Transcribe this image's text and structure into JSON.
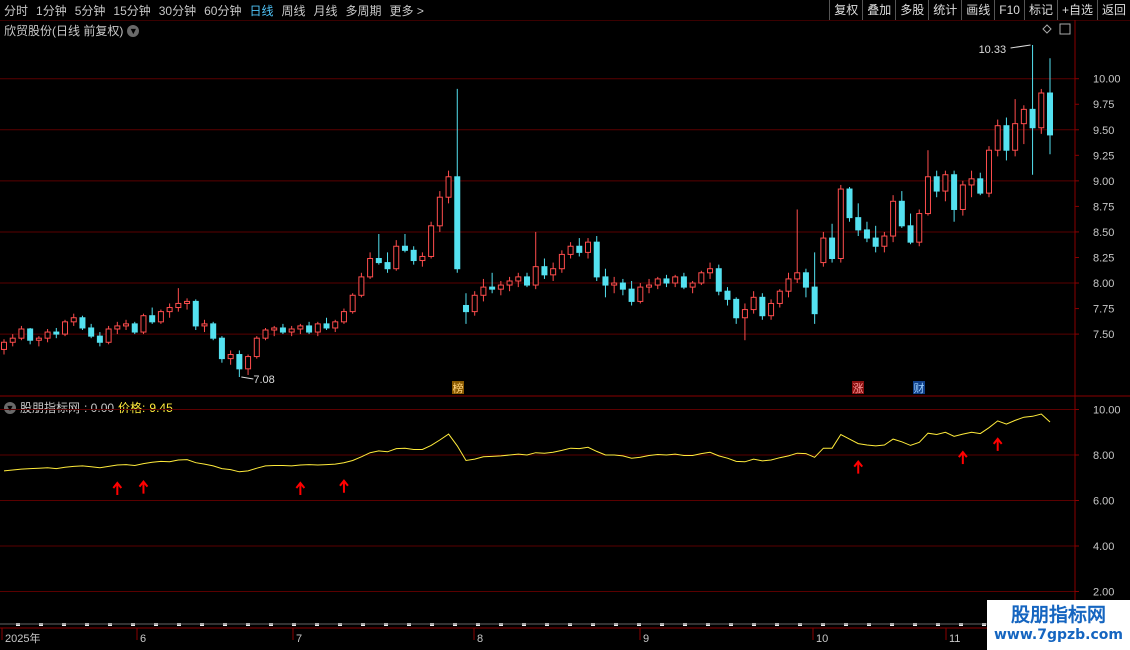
{
  "toolbar": {
    "periods": [
      "分时",
      "1分钟",
      "5分钟",
      "15分钟",
      "30分钟",
      "60分钟",
      "日线",
      "周线",
      "月线",
      "多周期",
      "更多 >"
    ],
    "active_index": 6,
    "tools": [
      "复权",
      "叠加",
      "多股",
      "统计",
      "画线",
      "F10",
      "标记",
      "+自选",
      "返回"
    ]
  },
  "main_chart": {
    "title": "欣贸股份(日线 前复权)",
    "y_axis_ticks": [
      "10.00",
      "9.75",
      "9.50",
      "9.25",
      "9.00",
      "8.75",
      "8.50",
      "8.25",
      "8.00",
      "7.75",
      "7.50"
    ],
    "high_label": "10.33",
    "low_label": "7.08",
    "event_markers": [
      "榜",
      "涨",
      "财"
    ]
  },
  "indicator": {
    "name": "股朋指标网",
    "value_text": ": 0.00",
    "price_label": "价格:",
    "price_value": "9.45",
    "y_axis_ticks": [
      "10.00",
      "8.00",
      "6.00",
      "4.00",
      "2.00"
    ]
  },
  "time_axis": {
    "labels": [
      "2025年",
      "6",
      "7",
      "8",
      "9",
      "10",
      "11"
    ]
  },
  "watermark": {
    "name": "股朋指标网",
    "url": "www.7gpzb.com"
  },
  "colors": {
    "up": "#ff4d4d",
    "down": "#54e1f0",
    "price_line": "#ffeb3b",
    "grid": "#5a0000",
    "axis_text": "#c8c8c8",
    "arrow": "#ff0000"
  },
  "chart_data": {
    "type": "candlestick",
    "period": "daily",
    "price_range": [
      7.0,
      10.4
    ],
    "candles": [
      [
        7.35,
        7.45,
        7.3,
        7.42
      ],
      [
        7.42,
        7.5,
        7.38,
        7.46
      ],
      [
        7.46,
        7.58,
        7.44,
        7.55
      ],
      [
        7.55,
        7.56,
        7.4,
        7.44
      ],
      [
        7.44,
        7.48,
        7.38,
        7.46
      ],
      [
        7.46,
        7.55,
        7.42,
        7.52
      ],
      [
        7.52,
        7.56,
        7.46,
        7.5
      ],
      [
        7.5,
        7.64,
        7.48,
        7.62
      ],
      [
        7.62,
        7.7,
        7.58,
        7.66
      ],
      [
        7.66,
        7.68,
        7.54,
        7.56
      ],
      [
        7.56,
        7.6,
        7.46,
        7.48
      ],
      [
        7.48,
        7.52,
        7.38,
        7.42
      ],
      [
        7.42,
        7.58,
        7.4,
        7.55
      ],
      [
        7.55,
        7.62,
        7.5,
        7.58
      ],
      [
        7.58,
        7.64,
        7.54,
        7.6
      ],
      [
        7.6,
        7.62,
        7.5,
        7.52
      ],
      [
        7.52,
        7.7,
        7.5,
        7.68
      ],
      [
        7.68,
        7.76,
        7.6,
        7.62
      ],
      [
        7.62,
        7.74,
        7.6,
        7.72
      ],
      [
        7.72,
        7.8,
        7.66,
        7.76
      ],
      [
        7.76,
        7.95,
        7.72,
        7.8
      ],
      [
        7.8,
        7.85,
        7.74,
        7.82
      ],
      [
        7.82,
        7.84,
        7.54,
        7.58
      ],
      [
        7.58,
        7.64,
        7.52,
        7.6
      ],
      [
        7.6,
        7.62,
        7.44,
        7.46
      ],
      [
        7.46,
        7.48,
        7.22,
        7.26
      ],
      [
        7.26,
        7.34,
        7.2,
        7.3
      ],
      [
        7.3,
        7.34,
        7.08,
        7.16
      ],
      [
        7.16,
        7.3,
        7.1,
        7.28
      ],
      [
        7.28,
        7.48,
        7.26,
        7.46
      ],
      [
        7.46,
        7.56,
        7.44,
        7.54
      ],
      [
        7.54,
        7.58,
        7.48,
        7.56
      ],
      [
        7.56,
        7.6,
        7.5,
        7.52
      ],
      [
        7.52,
        7.58,
        7.48,
        7.55
      ],
      [
        7.55,
        7.6,
        7.5,
        7.58
      ],
      [
        7.58,
        7.62,
        7.5,
        7.52
      ],
      [
        7.52,
        7.62,
        7.48,
        7.6
      ],
      [
        7.6,
        7.66,
        7.54,
        7.56
      ],
      [
        7.56,
        7.64,
        7.52,
        7.62
      ],
      [
        7.62,
        7.75,
        7.6,
        7.72
      ],
      [
        7.72,
        7.9,
        7.7,
        7.88
      ],
      [
        7.88,
        8.1,
        7.86,
        8.06
      ],
      [
        8.06,
        8.3,
        8.04,
        8.24
      ],
      [
        8.24,
        8.48,
        8.18,
        8.2
      ],
      [
        8.2,
        8.3,
        8.1,
        8.14
      ],
      [
        8.14,
        8.42,
        8.12,
        8.36
      ],
      [
        8.36,
        8.48,
        8.3,
        8.32
      ],
      [
        8.32,
        8.36,
        8.18,
        8.22
      ],
      [
        8.22,
        8.3,
        8.16,
        8.26
      ],
      [
        8.26,
        8.6,
        8.24,
        8.56
      ],
      [
        8.56,
        8.9,
        8.5,
        8.84
      ],
      [
        8.84,
        9.1,
        8.78,
        9.04
      ],
      [
        9.04,
        9.9,
        8.1,
        8.14
      ],
      [
        7.78,
        7.9,
        7.6,
        7.72
      ],
      [
        7.72,
        7.92,
        7.68,
        7.88
      ],
      [
        7.88,
        8.04,
        7.82,
        7.96
      ],
      [
        7.96,
        8.1,
        7.9,
        7.94
      ],
      [
        7.94,
        8.02,
        7.88,
        7.98
      ],
      [
        7.98,
        8.06,
        7.92,
        8.02
      ],
      [
        8.02,
        8.1,
        7.96,
        8.06
      ],
      [
        8.06,
        8.1,
        7.96,
        7.98
      ],
      [
        7.98,
        8.5,
        7.94,
        8.16
      ],
      [
        8.16,
        8.24,
        8.04,
        8.08
      ],
      [
        8.08,
        8.2,
        8.02,
        8.14
      ],
      [
        8.14,
        8.32,
        8.1,
        8.28
      ],
      [
        8.28,
        8.4,
        8.24,
        8.36
      ],
      [
        8.36,
        8.44,
        8.26,
        8.3
      ],
      [
        8.3,
        8.44,
        8.24,
        8.4
      ],
      [
        8.4,
        8.46,
        8.02,
        8.06
      ],
      [
        8.06,
        8.14,
        7.86,
        7.98
      ],
      [
        7.98,
        8.06,
        7.9,
        8.0
      ],
      [
        8.0,
        8.04,
        7.88,
        7.94
      ],
      [
        7.94,
        8.02,
        7.78,
        7.82
      ],
      [
        7.82,
        8.0,
        7.8,
        7.96
      ],
      [
        7.96,
        8.04,
        7.9,
        7.98
      ],
      [
        7.98,
        8.06,
        7.94,
        8.04
      ],
      [
        8.04,
        8.08,
        7.96,
        8.0
      ],
      [
        8.0,
        8.08,
        7.96,
        8.06
      ],
      [
        8.06,
        8.1,
        7.94,
        7.96
      ],
      [
        7.96,
        8.02,
        7.9,
        8.0
      ],
      [
        8.0,
        8.12,
        7.98,
        8.1
      ],
      [
        8.1,
        8.2,
        8.04,
        8.14
      ],
      [
        8.14,
        8.18,
        7.88,
        7.92
      ],
      [
        7.92,
        7.96,
        7.78,
        7.84
      ],
      [
        7.84,
        7.86,
        7.6,
        7.66
      ],
      [
        7.66,
        7.8,
        7.44,
        7.74
      ],
      [
        7.74,
        7.92,
        7.7,
        7.86
      ],
      [
        7.86,
        7.9,
        7.64,
        7.68
      ],
      [
        7.68,
        7.84,
        7.64,
        7.8
      ],
      [
        7.8,
        7.94,
        7.76,
        7.92
      ],
      [
        7.92,
        8.1,
        7.86,
        8.04
      ],
      [
        8.04,
        8.72,
        8.0,
        8.1
      ],
      [
        8.1,
        8.14,
        7.86,
        7.96
      ],
      [
        7.96,
        8.3,
        7.6,
        7.7
      ],
      [
        8.2,
        8.5,
        8.16,
        8.44
      ],
      [
        8.44,
        8.58,
        8.2,
        8.24
      ],
      [
        8.24,
        8.96,
        8.2,
        8.92
      ],
      [
        8.92,
        8.94,
        8.6,
        8.64
      ],
      [
        8.64,
        8.78,
        8.46,
        8.52
      ],
      [
        8.52,
        8.6,
        8.4,
        8.44
      ],
      [
        8.44,
        8.56,
        8.3,
        8.36
      ],
      [
        8.36,
        8.5,
        8.3,
        8.46
      ],
      [
        8.46,
        8.86,
        8.4,
        8.8
      ],
      [
        8.8,
        8.9,
        8.54,
        8.56
      ],
      [
        8.56,
        8.68,
        8.38,
        8.4
      ],
      [
        8.4,
        8.72,
        8.36,
        8.68
      ],
      [
        8.68,
        9.3,
        8.66,
        9.04
      ],
      [
        9.04,
        9.1,
        8.84,
        8.9
      ],
      [
        8.9,
        9.1,
        8.8,
        9.06
      ],
      [
        9.06,
        9.1,
        8.6,
        8.72
      ],
      [
        8.72,
        9.0,
        8.66,
        8.96
      ],
      [
        8.96,
        9.1,
        8.84,
        9.02
      ],
      [
        9.02,
        9.08,
        8.86,
        8.88
      ],
      [
        8.88,
        9.34,
        8.84,
        9.3
      ],
      [
        9.3,
        9.6,
        9.24,
        9.54
      ],
      [
        9.54,
        9.62,
        9.2,
        9.3
      ],
      [
        9.3,
        9.8,
        9.24,
        9.56
      ],
      [
        9.56,
        9.74,
        9.36,
        9.7
      ],
      [
        9.7,
        10.33,
        9.06,
        9.52
      ],
      [
        9.52,
        9.9,
        9.46,
        9.86
      ],
      [
        9.86,
        10.2,
        9.26,
        9.45
      ]
    ],
    "indicator_series": {
      "name": "价格",
      "y_range": [
        1.5,
        10.8
      ],
      "values": [
        7.3,
        7.34,
        7.38,
        7.4,
        7.42,
        7.44,
        7.4,
        7.46,
        7.5,
        7.52,
        7.48,
        7.44,
        7.5,
        7.56,
        7.58,
        7.54,
        7.62,
        7.68,
        7.72,
        7.7,
        7.78,
        7.8,
        7.66,
        7.6,
        7.52,
        7.4,
        7.36,
        7.26,
        7.3,
        7.42,
        7.52,
        7.54,
        7.54,
        7.52,
        7.56,
        7.58,
        7.56,
        7.58,
        7.6,
        7.66,
        7.76,
        7.92,
        8.1,
        8.18,
        8.14,
        8.28,
        8.3,
        8.24,
        8.24,
        8.42,
        8.66,
        8.92,
        8.4,
        7.76,
        7.82,
        7.92,
        7.94,
        7.96,
        8.0,
        8.04,
        8.0,
        8.1,
        8.08,
        8.12,
        8.2,
        8.3,
        8.28,
        8.34,
        8.16,
        8.0,
        8.0,
        7.96,
        7.86,
        7.9,
        7.98,
        8.02,
        8.0,
        8.04,
        7.98,
        7.98,
        8.06,
        8.12,
        7.96,
        7.86,
        7.72,
        7.7,
        7.82,
        7.74,
        7.78,
        7.88,
        7.96,
        8.08,
        8.06,
        7.9,
        8.3,
        8.3,
        8.9,
        8.7,
        8.5,
        8.44,
        8.4,
        8.44,
        8.7,
        8.58,
        8.42,
        8.56,
        8.96,
        8.9,
        9.0,
        8.82,
        8.92,
        9.0,
        8.94,
        9.2,
        9.5,
        9.36,
        9.52,
        9.66,
        9.7,
        9.8,
        9.45
      ]
    },
    "signal_arrows_index": [
      13,
      16,
      34,
      39,
      98,
      110,
      114
    ]
  }
}
